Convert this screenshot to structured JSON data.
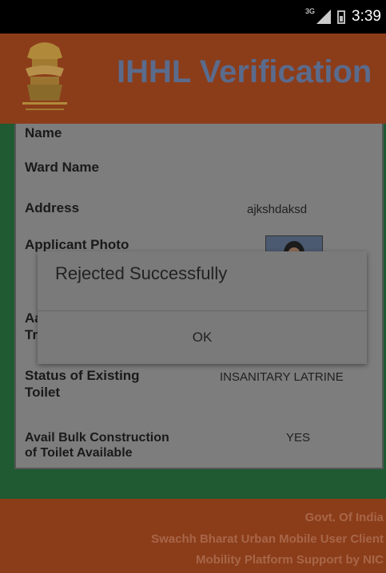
{
  "status_bar": {
    "network": "3G",
    "time": "3:39"
  },
  "header": {
    "title": "IHHL Verification",
    "emblem_caption": "सत्यमेव जयते"
  },
  "fields": [
    {
      "label": "Name",
      "value": ""
    },
    {
      "label": "Ward Name",
      "value": ""
    },
    {
      "label": "Address",
      "value": "ajkshdaksd"
    },
    {
      "label": "Applicant Photo",
      "value": ""
    },
    {
      "label": "Aa",
      "label2": "Tr",
      "value": ""
    },
    {
      "label": "Status of Existing",
      "label2": "Toilet",
      "value": "INSANITARY LATRINE"
    },
    {
      "label": "Avail Bulk Construction",
      "label2": "of Toilet Available",
      "value": "YES"
    }
  ],
  "dialog": {
    "message": "Rejected Successfully",
    "ok_label": "OK"
  },
  "footer": {
    "line1": "Govt. Of India",
    "line2": "Swachh Bharat Urban Mobile User Client",
    "line3": "Mobility Platform Support by NIC"
  }
}
